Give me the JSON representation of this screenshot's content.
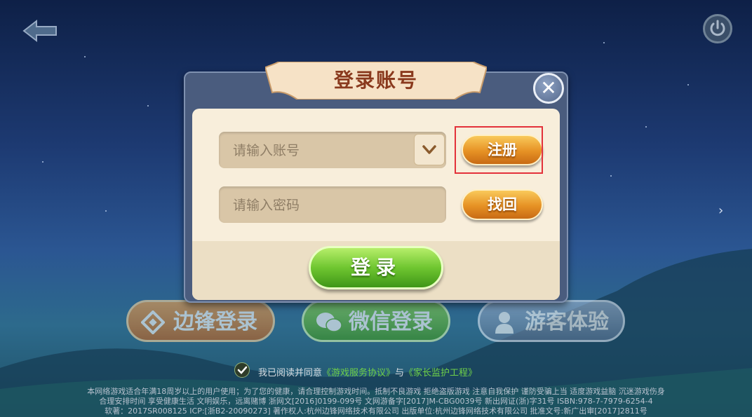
{
  "dialog": {
    "title": "登录账号",
    "close_label": "✕"
  },
  "form": {
    "account_placeholder": "请输入账号",
    "password_placeholder": "请输入密码",
    "register_label": "注册",
    "recover_label": "找回",
    "login_label": "登录"
  },
  "login_options": {
    "bianfeng": "边锋登录",
    "wechat": "微信登录",
    "guest": "游客体验"
  },
  "agreement": {
    "prefix": "我已阅读并同意",
    "link1": "《游戏服务协议》",
    "joiner": "与",
    "link2": "《家长监护工程》"
  },
  "footer": {
    "line1": "本网络游戏适合年满18周岁以上的用户使用；为了您的健康，请合理控制游戏时间。抵制不良游戏 拒绝盗版游戏 注意自我保护 谨防受骗上当 适度游戏益脑 沉迷游戏伤身",
    "line2": "合理安排时间 享受健康生活 文明娱乐，远离赌博 浙网文[2016]0199-099号 文网游备字[2017]M-CBG0039号 新出网证(浙)字31号 ISBN:978-7-7979-6254-4",
    "line3": "软著：2017SR008125 ICP:[浙B2-20090273] 著作权人:杭州边锋网络技术有限公司 出版单位:杭州边锋网络技术有限公司 批准文号:新广出审[2017]2811号"
  },
  "colors": {
    "register_highlight": "#e3313a",
    "orange_button": "#e69124",
    "green_button": "#6fc630",
    "link_green": "#6fd049"
  }
}
